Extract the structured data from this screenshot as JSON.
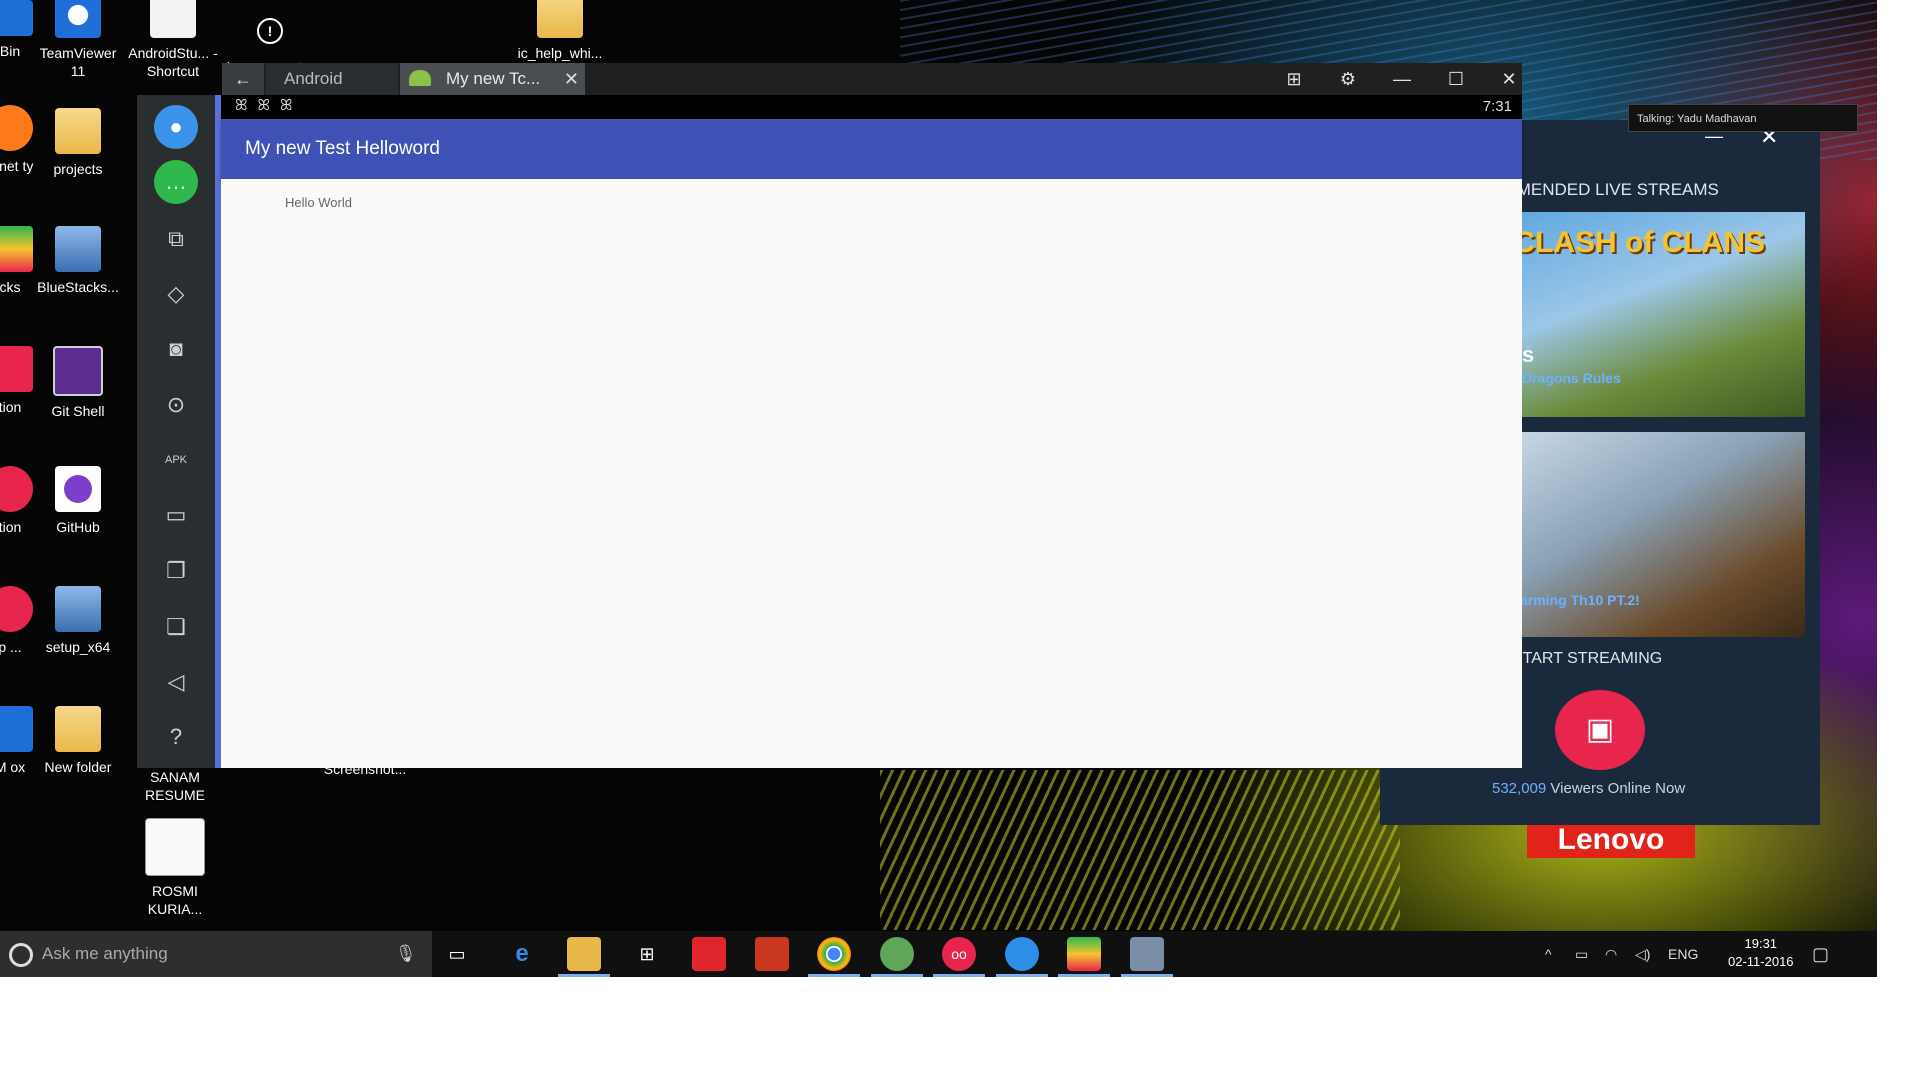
{
  "desktop": {
    "icons": [
      {
        "label": "Bin"
      },
      {
        "label": "TeamViewer 11"
      },
      {
        "label": "AndroidStu... - Shortcut"
      },
      {
        "label": "ic_error_out..."
      },
      {
        "label": "ic_help_whi..."
      },
      {
        "label": "ernet ty"
      },
      {
        "label": "projects"
      },
      {
        "label": "cks"
      },
      {
        "label": "BlueStacks..."
      },
      {
        "label": "tion"
      },
      {
        "label": "Git Shell"
      },
      {
        "label": "tion"
      },
      {
        "label": "GitHub"
      },
      {
        "label": "p ..."
      },
      {
        "label": "setup_x64"
      },
      {
        "label": "M ox"
      },
      {
        "label": "New folder"
      },
      {
        "label": "SANAM RESUME"
      },
      {
        "label": "Screenshot..."
      },
      {
        "label": "ROSMI KURIA..."
      }
    ]
  },
  "bluestacks": {
    "back_label": "←",
    "tabs": [
      {
        "label": "Android"
      },
      {
        "label": "My new Tc..."
      }
    ],
    "tab_close": "✕",
    "controls": {
      "network": "⊞",
      "settings": "⚙",
      "minimize": "—",
      "maximize": "☐",
      "close": "✕"
    },
    "sidebar_icons": [
      "video-camera-icon",
      "chat-icon",
      "multi-window-icon",
      "rotate-icon",
      "screenshot-icon",
      "location-icon",
      "apk-icon",
      "folder-icon",
      "copy-icon",
      "paste-icon",
      "volume-icon",
      "help-icon"
    ],
    "status": {
      "time": "7:31",
      "bugs": "ꕤꕤꕤ"
    },
    "app_title": "My new Test Helloword",
    "hello_text": "Hello World"
  },
  "live_panel": {
    "minimize": "—",
    "close": "✕",
    "heading": "IMENDED LIVE STREAMS",
    "stream1_logo": "CLASH of CLANS",
    "stream1_title": "Dragons Rules",
    "stream1_prefix": "s",
    "stream2_title": "arming Th10 PT.2!",
    "start_label": "START STREAMING",
    "viewers_count": "532,009",
    "viewers_text": "Viewers Online Now"
  },
  "tooltip": "Talking: Yadu Madhavan",
  "wallpaper_brand": "Lenovo",
  "taskbar": {
    "search_placeholder": "Ask me anything",
    "tray_lang": "ENG",
    "clock_time": "19:31",
    "clock_date": "02-11-2016"
  },
  "colors": {
    "app_bar": "#3f51b5",
    "record_button": "#e8264d",
    "accent_border": "#5a6fd8"
  }
}
